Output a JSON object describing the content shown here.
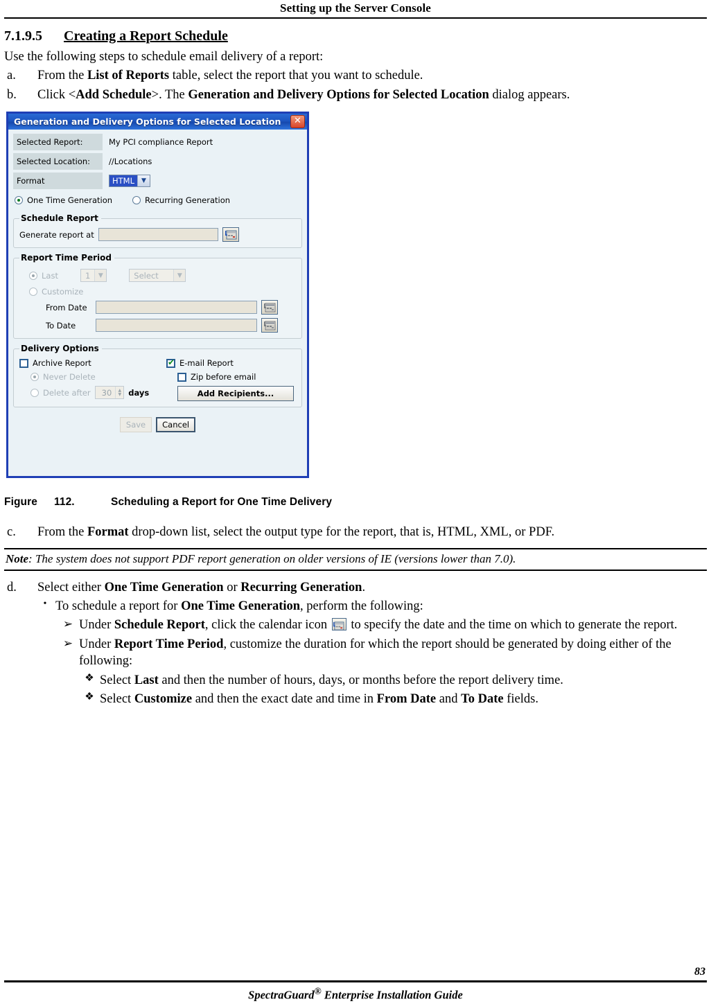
{
  "header": {
    "title": "Setting up the Server Console"
  },
  "section": {
    "number": "7.1.9.5",
    "title": "Creating a Report Schedule",
    "intro": "Use the following steps to schedule email delivery of a report:"
  },
  "steps": {
    "a": {
      "marker": "a.",
      "text_1": "From the ",
      "bold_1": "List of Reports",
      "text_2": " table, select the report that you want to schedule."
    },
    "b": {
      "marker": "b.",
      "text_1": "Click <",
      "bold_1": "Add Schedule",
      "text_2": ">. The ",
      "bold_2": "Generation and Delivery Options for Selected Location",
      "text_3": " dialog appears."
    },
    "c": {
      "marker": "c.",
      "text_1": "From the ",
      "bold_1": "Format",
      "text_2": " drop-down list, select the output type for the report, that is, HTML, XML, or PDF."
    },
    "d": {
      "marker": "d.",
      "text_1": "Select either ",
      "bold_1": "One Time Generation",
      "text_2": " or ",
      "bold_2": "Recurring Generation",
      "text_3": "."
    }
  },
  "sublist": {
    "bullet": "•",
    "arrow": "➢",
    "diamond": "❖",
    "b1": {
      "text_1": "To schedule a report for ",
      "bold_1": "One Time Generation",
      "text_2": ", perform the following:"
    },
    "a1": {
      "text_1": "Under ",
      "bold_1": "Schedule Report",
      "text_2": ", click the calendar icon ",
      "text_3": " to specify the date and the time on which to generate the report."
    },
    "a2": {
      "text_1": "Under ",
      "bold_1": "Report Time Period",
      "text_2": ", customize the duration for which the report should be generated by doing either of the following:"
    },
    "d1": {
      "text_1": "Select ",
      "bold_1": "Last",
      "text_2": " and then the number of hours, days, or months before the report delivery time."
    },
    "d2": {
      "text_1": "Select ",
      "bold_1": "Customize",
      "text_2": " and then the exact date and time in ",
      "bold_2": "From Date",
      "text_3": " and ",
      "bold_3": "To Date",
      "text_4": " fields."
    }
  },
  "figure": {
    "label": "Figure",
    "number": "112.",
    "caption": "Scheduling a Report for One Time Delivery"
  },
  "note": {
    "label": "Note",
    "text": ": The system does not support PDF report generation on older versions of IE (versions lower than 7.0)."
  },
  "footer": {
    "page_number": "83",
    "guide_title_1": "SpectraGuard",
    "guide_reg": "®",
    "guide_title_2": " Enterprise Installation Guide"
  },
  "dialog": {
    "title": "Generation and Delivery Options for Selected Location",
    "close_label": "✕",
    "fields": {
      "selected_report_label": "Selected Report:",
      "selected_report_value": "My PCI compliance Report",
      "selected_location_label": "Selected Location:",
      "selected_location_value": "//Locations",
      "format_label": "Format",
      "format_value": "HTML",
      "dropdown_arrow": "▼"
    },
    "generation_mode": {
      "one_time_label": "One Time Generation",
      "recurring_label": "Recurring Generation",
      "selected": "One Time Generation"
    },
    "schedule_report": {
      "legend": "Schedule Report",
      "generate_at_label": "Generate report at",
      "generate_at_value": ""
    },
    "report_time_period": {
      "legend": "Report Time Period",
      "last_label": "Last",
      "last_count_value": "1",
      "unit_value": "Select",
      "customize_label": "Customize",
      "from_date_label": "From Date",
      "from_date_value": "",
      "to_date_label": "To Date",
      "to_date_value": "",
      "selected": "Last"
    },
    "delivery_options": {
      "legend": "Delivery Options",
      "archive_report_label": "Archive Report",
      "archive_report_checked": false,
      "never_delete_label": "Never Delete",
      "delete_after_label": "Delete after",
      "delete_after_value": "30",
      "days_label": "days",
      "email_report_label": "E-mail Report",
      "email_report_checked": true,
      "zip_before_email_label": "Zip before email",
      "zip_before_email_checked": false,
      "add_recipients_label": "Add Recipients..."
    },
    "buttons": {
      "save_label": "Save",
      "cancel_label": "Cancel"
    },
    "colors": {
      "titlebar_blue": "#1d55c0",
      "dialog_border": "#1f3fb5",
      "body_bg": "#eaf2f6",
      "label_bg": "#cfdadd",
      "select_highlight": "#2a4fc4",
      "field_bg": "#e8e4d8",
      "check_green": "#0b8a1e",
      "close_red": "#d9442a"
    }
  }
}
